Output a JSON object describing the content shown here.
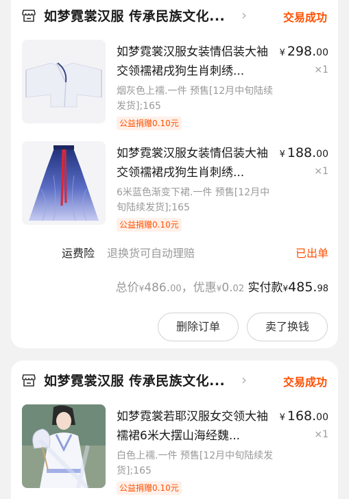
{
  "orders": [
    {
      "shop_name": "如梦霓裳汉服 传承民族文化...",
      "status": "交易成功",
      "items": [
        {
          "title": "如梦霓裳汉服女装情侣装大袖交领襦裙戌狗生肖刺绣...",
          "price_yen": "¥",
          "price_main": "298.",
          "price_cents": "00",
          "qty": "×1",
          "spec": "烟灰色上襦.一件 预售[12月中旬陆续发货];165",
          "charity": "公益捐赠0.10元",
          "image": "white-hanfu-top"
        },
        {
          "title": "如梦霓裳汉服女装情侣装大袖交领襦裙戌狗生肖刺绣...",
          "price_yen": "¥",
          "price_main": "188.",
          "price_cents": "00",
          "qty": "×1",
          "spec": "6米蓝色渐变下裙.一件 预售[12月中旬陆续发货];165",
          "charity": "公益捐赠0.10元",
          "image": "blue-gradient-skirt"
        }
      ],
      "insurance_label": "运费险",
      "insurance_desc": "退换货可自动理赔",
      "insurance_status": "已出单",
      "total": {
        "total_label": "总价",
        "total_yen": "¥",
        "total_main": "486.",
        "total_cents": "00",
        "sep": "，",
        "discount_label": "优惠",
        "discount_yen": "¥",
        "discount_main": "0.",
        "discount_cents": "02",
        "paid_label": "实付款",
        "paid_yen": "¥",
        "paid_main": "485.",
        "paid_cents": "98"
      },
      "buttons": {
        "delete": "删除订单",
        "sell": "卖了换钱"
      }
    },
    {
      "shop_name": "如梦霓裳汉服 传承民族文化...",
      "status": "交易成功",
      "items": [
        {
          "title": "如梦霓裳若耶汉服女交领大袖襦裙6米大摆山海经魏...",
          "price_yen": "¥",
          "price_main": "168.",
          "price_cents": "00",
          "qty": "×1",
          "spec": "白色上襦.一件 预售[12月中旬陆续发货];165",
          "charity": "公益捐赠0.10元",
          "image": "model-in-hanfu"
        }
      ]
    }
  ],
  "colors": {
    "accent": "#ff5000",
    "muted": "#999999",
    "background": "#f2f2f2"
  },
  "icons": {
    "shop": "store-icon",
    "chevron": "chevron-right-icon"
  }
}
